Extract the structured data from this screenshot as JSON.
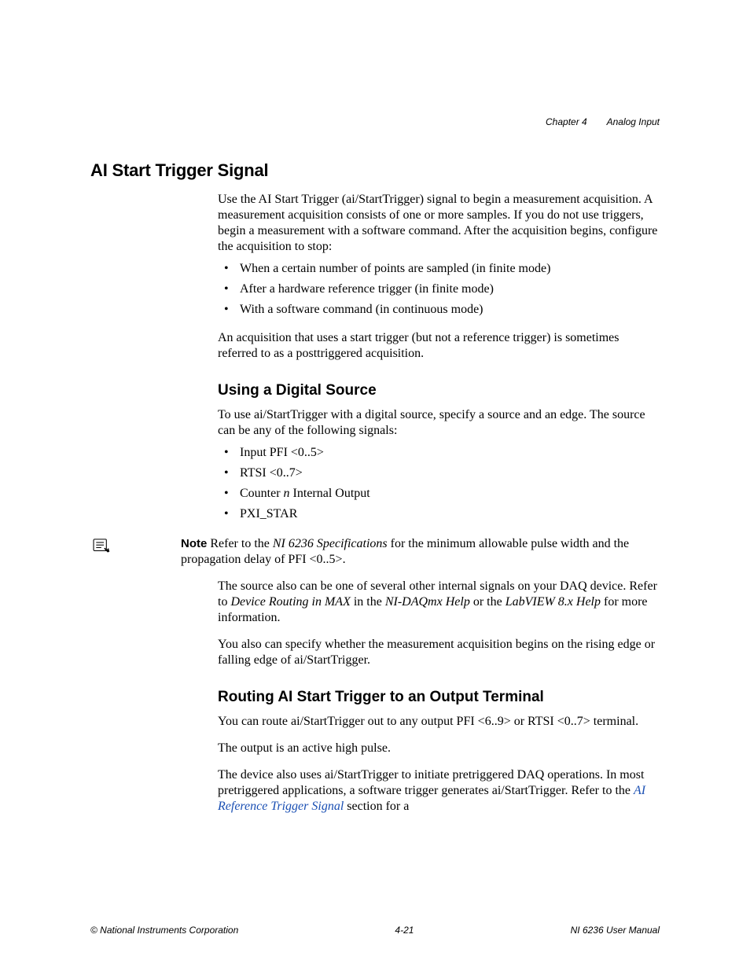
{
  "header": {
    "chapter": "Chapter 4",
    "title": "Analog Input"
  },
  "section1": {
    "heading": "AI Start Trigger Signal",
    "p1": "Use the AI Start Trigger (ai/StartTrigger) signal to begin a measurement acquisition. A measurement acquisition consists of one or more samples. If you do not use triggers, begin a measurement with a software command. After the acquisition begins, configure the acquisition to stop:",
    "bullets": [
      "When a certain number of points are sampled (in finite mode)",
      "After a hardware reference trigger (in finite mode)",
      "With a software command (in continuous mode)"
    ],
    "p2": "An acquisition that uses a start trigger (but not a reference trigger) is sometimes referred to as a posttriggered acquisition."
  },
  "section2": {
    "heading": "Using a Digital Source",
    "p1": "To use ai/StartTrigger with a digital source, specify a source and an edge. The source can be any of the following signals:",
    "bullets": {
      "b1": "Input PFI <0..5>",
      "b2": "RTSI <0..7>",
      "b3a": "Counter ",
      "b3i": "n",
      "b3b": " Internal Output",
      "b4": "PXI_STAR"
    }
  },
  "note": {
    "label": "Note",
    "t1": "   Refer to the ",
    "i1": "NI 6236 Specifications",
    "t2": " for the minimum allowable pulse width and the propagation delay of PFI <0..5>."
  },
  "section2b": {
    "p2a": "The source also can be one of several other internal signals on your DAQ device. Refer to ",
    "p2i1": "Device Routing in MAX",
    "p2b": " in the ",
    "p2i2": "NI-DAQmx Help",
    "p2c": " or the ",
    "p2i3": "LabVIEW 8.x Help",
    "p2d": " for more information.",
    "p3": "You also can specify whether the measurement acquisition begins on the rising edge or falling edge of ai/StartTrigger."
  },
  "section3": {
    "heading": "Routing AI Start Trigger to an Output Terminal",
    "p1": "You can route ai/StartTrigger out to any output PFI <6..9> or RTSI <0..7> terminal.",
    "p2": "The output is an active high pulse.",
    "p3a": "The device also uses ai/StartTrigger to initiate pretriggered DAQ operations. In most pretriggered applications, a software trigger generates ai/StartTrigger. Refer to the ",
    "p3link": "AI Reference Trigger Signal",
    "p3b": " section for a"
  },
  "footer": {
    "copyright": "© National Instruments Corporation",
    "page": "4-21",
    "manual": "NI 6236 User Manual"
  }
}
